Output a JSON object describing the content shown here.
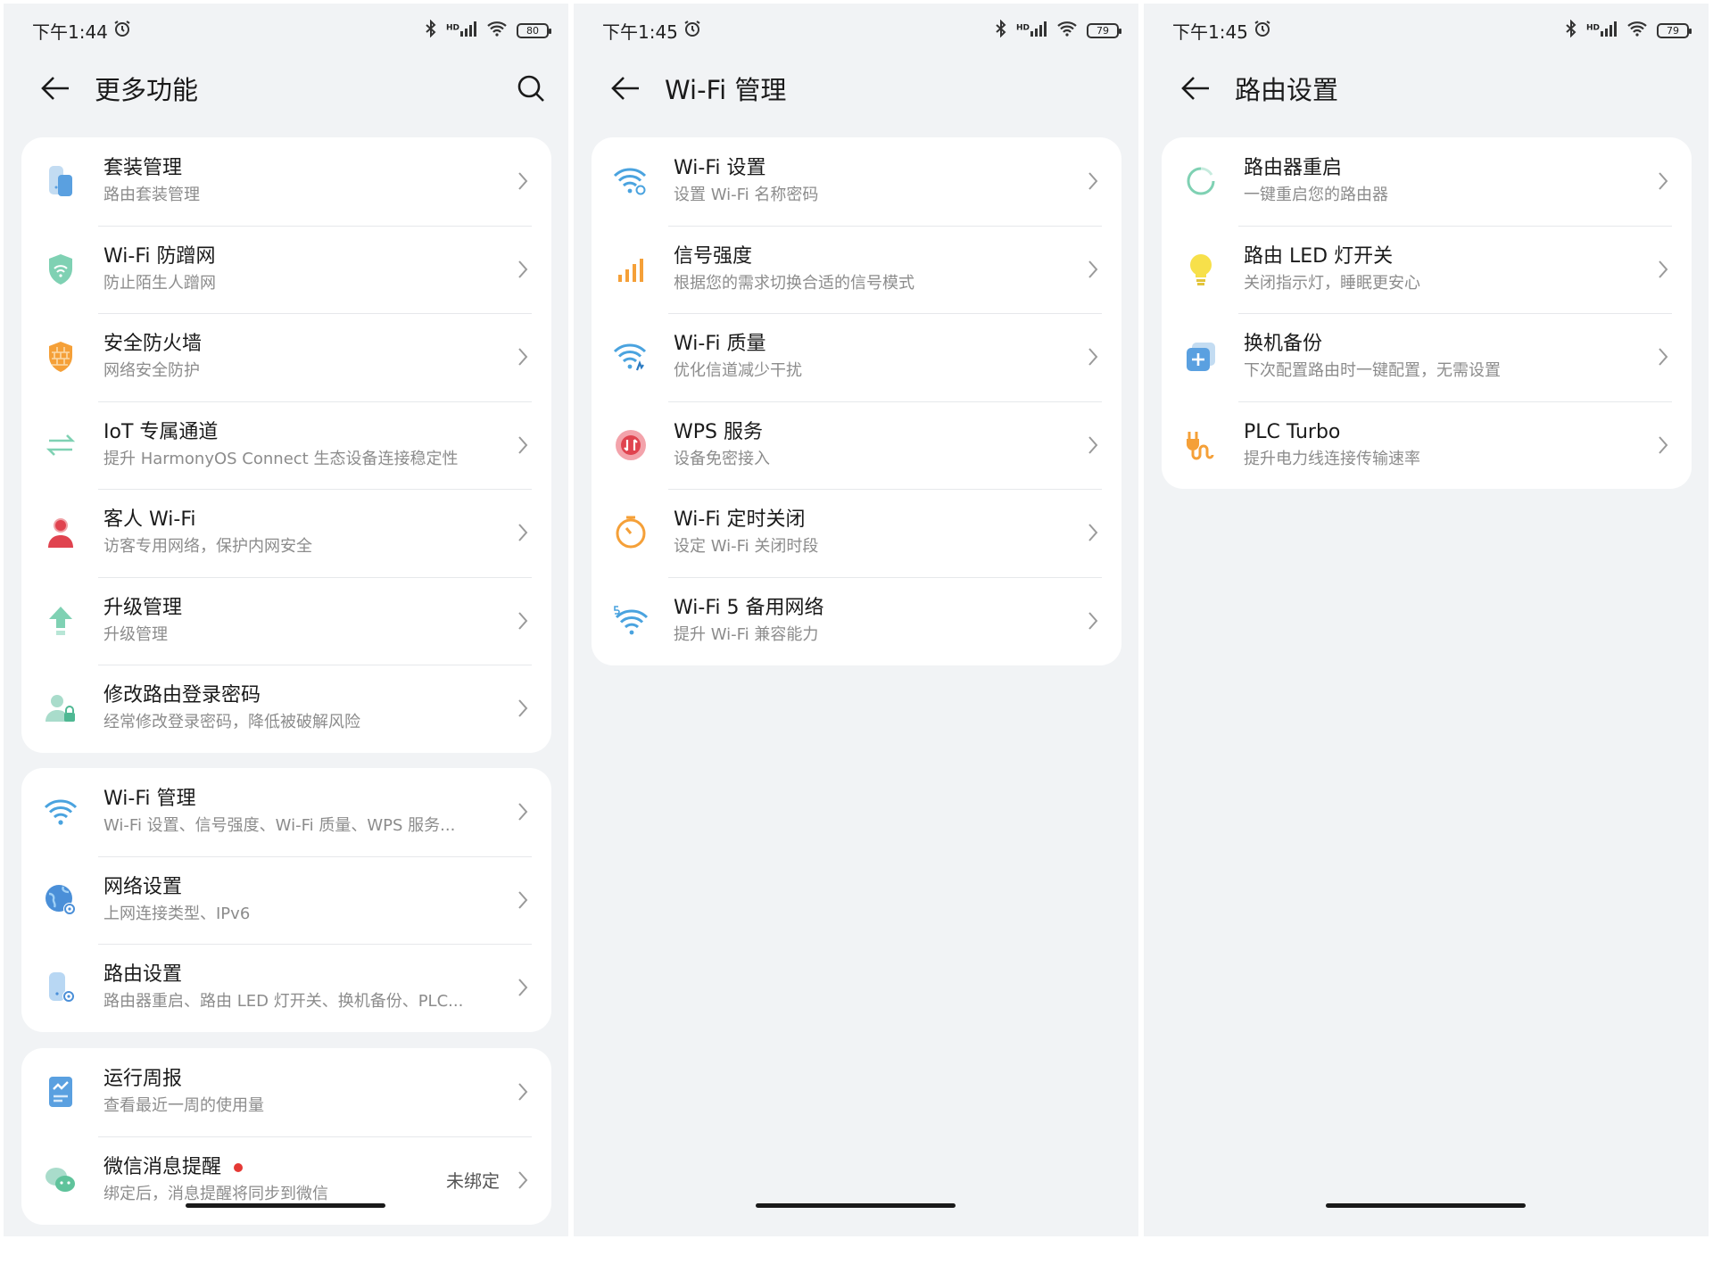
{
  "colors": {
    "background": "#f1f3f5",
    "card": "#ffffff",
    "subtitle": "#8c8c8c",
    "badge": "#e53935"
  },
  "panel1": {
    "status": {
      "time": "下午1:44",
      "battery": "80"
    },
    "title": "更多功能",
    "group1": [
      {
        "title": "套装管理",
        "subtitle": "路由套装管理",
        "icon": "router-set-icon"
      },
      {
        "title": "Wi-Fi 防蹭网",
        "subtitle": "防止陌生人蹭网",
        "icon": "shield-icon"
      },
      {
        "title": "安全防火墙",
        "subtitle": "网络安全防护",
        "icon": "firewall-icon"
      },
      {
        "title": "IoT 专属通道",
        "subtitle": "提升 HarmonyOS Connect 生态设备连接稳定性",
        "icon": "iot-channel-icon"
      },
      {
        "title": "客人 Wi-Fi",
        "subtitle": "访客专用网络，保护内网安全",
        "icon": "guest-icon"
      },
      {
        "title": "升级管理",
        "subtitle": "升级管理",
        "icon": "upgrade-icon"
      },
      {
        "title": "修改路由登录密码",
        "subtitle": "经常修改登录密码，降低被破解风险",
        "icon": "user-lock-icon"
      }
    ],
    "group2": [
      {
        "title": "Wi-Fi 管理",
        "subtitle": "Wi-Fi 设置、信号强度、Wi-Fi 质量、WPS 服务...",
        "icon": "wifi-icon"
      },
      {
        "title": "网络设置",
        "subtitle": "上网连接类型、IPv6",
        "icon": "globe-settings-icon"
      },
      {
        "title": "路由设置",
        "subtitle": "路由器重启、路由 LED 灯开关、换机备份、PLC...",
        "icon": "router-settings-icon"
      }
    ],
    "group3": [
      {
        "title": "运行周报",
        "subtitle": "查看最近一周的使用量",
        "icon": "report-icon"
      },
      {
        "title": "微信消息提醒",
        "subtitle": "绑定后，消息提醒将同步到微信",
        "icon": "wechat-icon",
        "value": "未绑定"
      }
    ]
  },
  "panel2": {
    "status": {
      "time": "下午1:45",
      "battery": "79"
    },
    "title": "Wi-Fi 管理",
    "items": [
      {
        "title": "Wi-Fi 设置",
        "subtitle": "设置 Wi-Fi 名称密码",
        "icon": "wifi-settings-icon"
      },
      {
        "title": "信号强度",
        "subtitle": "根据您的需求切换合适的信号模式",
        "icon": "signal-bars-icon"
      },
      {
        "title": "Wi-Fi 质量",
        "subtitle": "优化信道减少干扰",
        "icon": "wifi-quality-icon"
      },
      {
        "title": "WPS 服务",
        "subtitle": "设备免密接入",
        "icon": "wps-icon"
      },
      {
        "title": "Wi-Fi 定时关闭",
        "subtitle": "设定 Wi-Fi 关闭时段",
        "icon": "timer-icon"
      },
      {
        "title": "Wi-Fi 5 备用网络",
        "subtitle": "提升 Wi-Fi 兼容能力",
        "icon": "wifi5-icon"
      }
    ]
  },
  "panel3": {
    "status": {
      "time": "下午1:45",
      "battery": "79"
    },
    "title": "路由设置",
    "items": [
      {
        "title": "路由器重启",
        "subtitle": "一键重启您的路由器",
        "icon": "restart-icon"
      },
      {
        "title": "路由 LED 灯开关",
        "subtitle": "关闭指示灯，睡眠更安心",
        "icon": "bulb-icon"
      },
      {
        "title": "换机备份",
        "subtitle": "下次配置路由时一键配置，无需设置",
        "icon": "backup-icon"
      },
      {
        "title": "PLC Turbo",
        "subtitle": "提升电力线连接传输速率",
        "icon": "plug-icon"
      }
    ]
  }
}
